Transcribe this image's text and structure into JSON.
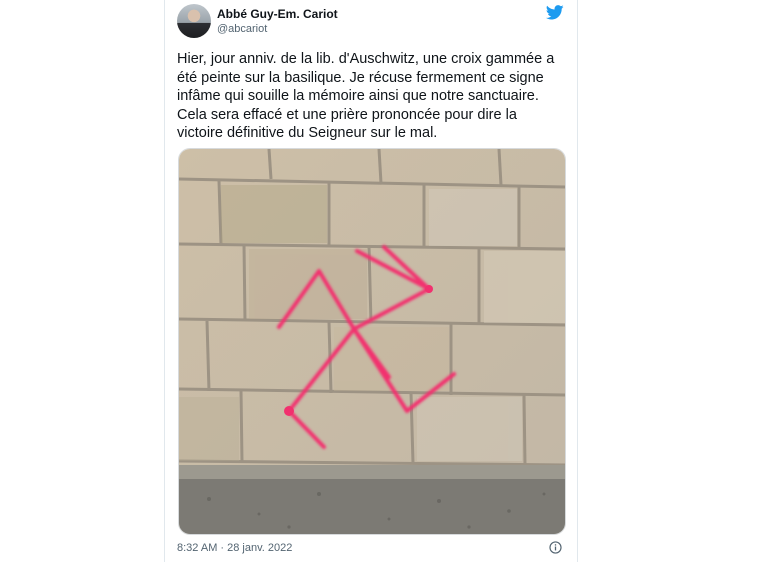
{
  "tweet": {
    "author_name": "Abbé Guy-Em. Cariot",
    "author_handle": "@abcariot",
    "text": "Hier, jour anniv. de la lib. d'Auschwitz, une croix gammée a\nété peinte sur la basilique. Je récuse fermement ce signe\ninfâme qui souille la mémoire ainsi que notre sanctuaire.\nCela sera effacé et une prière prononcée pour dire la\nvictoire définitive du Seigneur sur le mal.",
    "timestamp": "8:32 AM · 28 janv. 2022"
  },
  "icons": {
    "brand": "twitter-bird-icon",
    "info": "info-icon"
  },
  "colors": {
    "twitter_blue": "#1d9bf0",
    "paint_pink": "#f2306e",
    "secondary_text": "#536471"
  }
}
